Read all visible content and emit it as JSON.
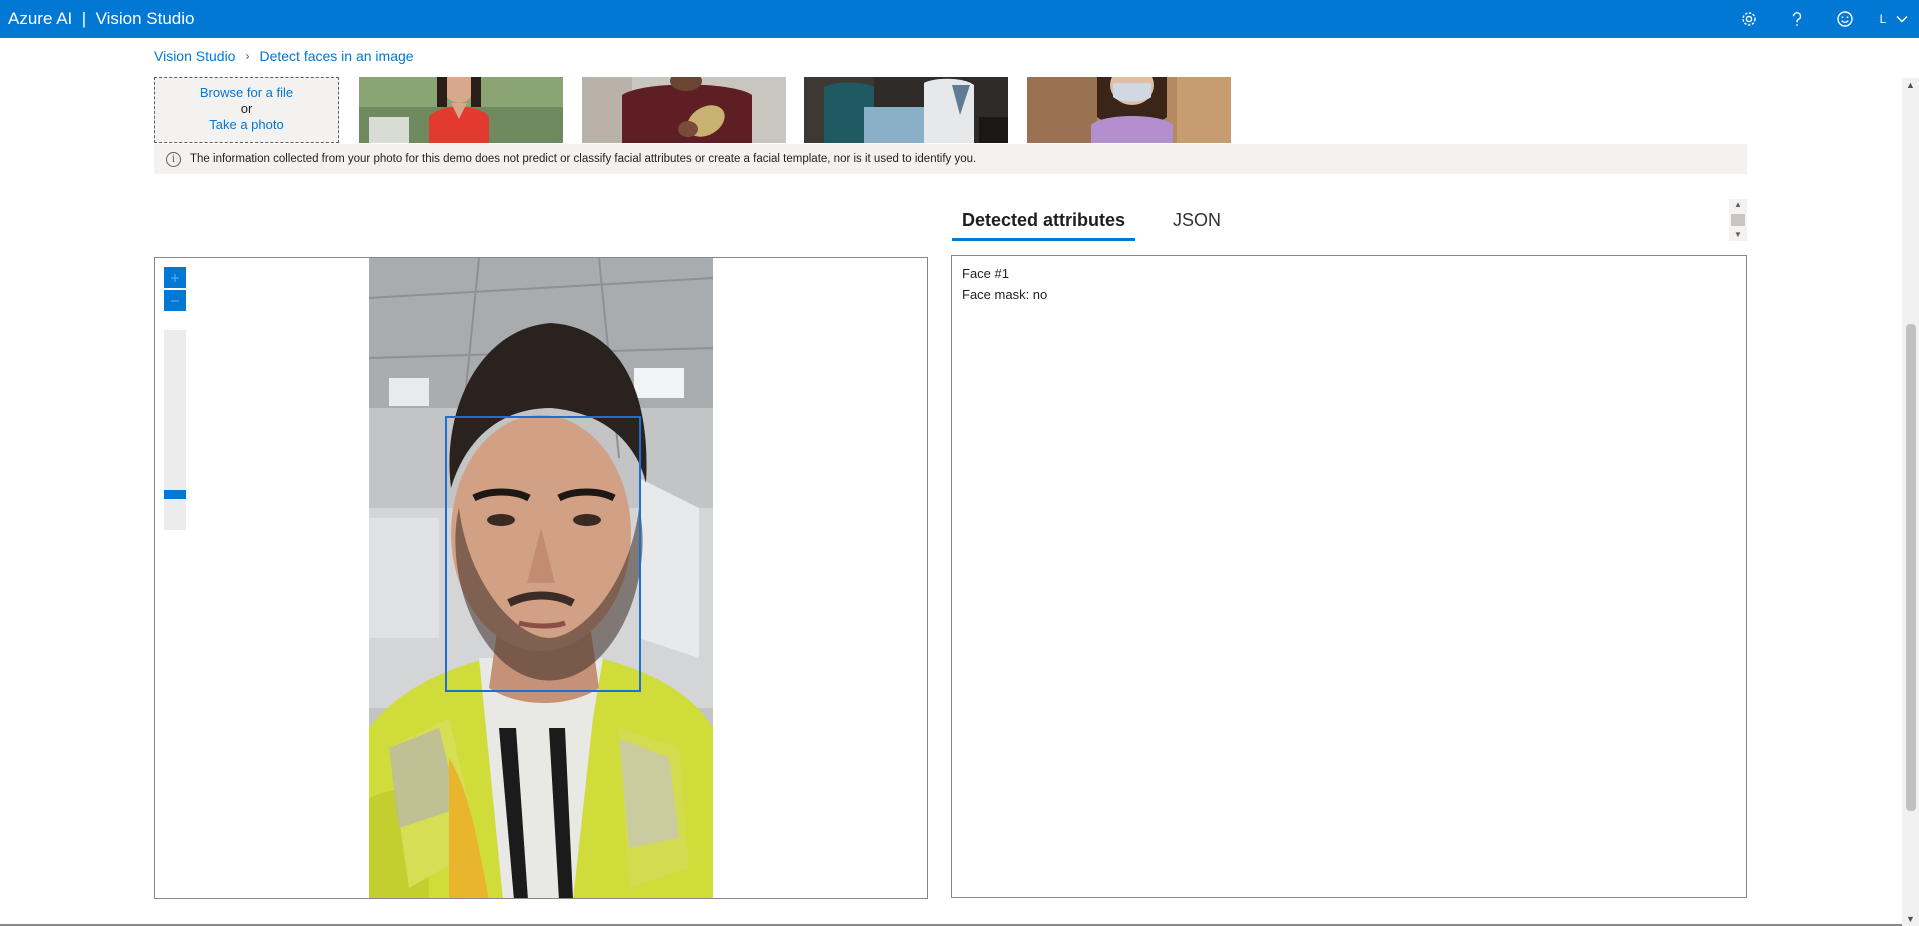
{
  "header": {
    "title": "Azure AI  |  Vision Studio",
    "avatar_initial": "L",
    "icons": [
      "gear-icon",
      "help-icon",
      "feedback-smiley-icon",
      "chevron-down-icon"
    ]
  },
  "breadcrumb": {
    "items": [
      "Vision Studio",
      "Detect faces in an image"
    ],
    "separator": "›"
  },
  "upload": {
    "cut_text": "or",
    "browse_label": "Browse for a file",
    "or_label": "or",
    "photo_label": "Take a photo"
  },
  "info": {
    "icon": "info-icon",
    "text": "The information collected from your photo for this demo does not predict or classify facial attributes or create a facial template, nor is it used to identify you."
  },
  "tabs": {
    "items": [
      "Detected attributes",
      "JSON"
    ],
    "active": "Detected attributes"
  },
  "results": {
    "face_label": "Face #1",
    "face_mask": "Face mask: no"
  },
  "zoom": {
    "in_icon": "plus-icon",
    "out_icon": "minus-icon",
    "level": 0.1
  },
  "colors": {
    "brand": "#0078d4",
    "face_box": "#1e6fd1",
    "info_bg": "#f3f2f1"
  }
}
